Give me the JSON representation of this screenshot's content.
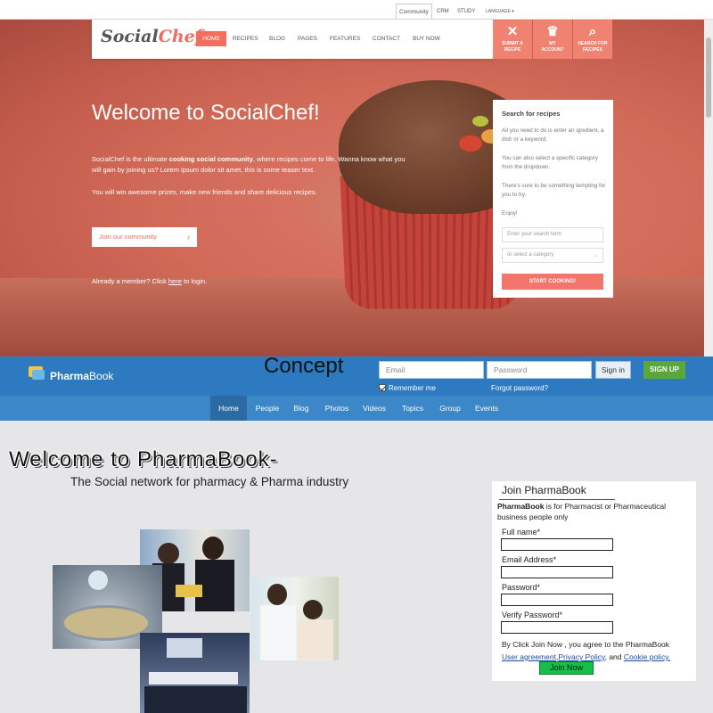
{
  "top_tabs": [
    "Community",
    "CRM",
    "STUDY",
    "LANGUAGE ▾"
  ],
  "socialchef": {
    "logo": {
      "part1": "Social",
      "part2": "Chef"
    },
    "nav": [
      "HOME",
      "RECIPES",
      "BLOG",
      "PAGES",
      "FEATURES",
      "CONTACT",
      "BUY NOW"
    ],
    "tiles": [
      {
        "icon": "✕",
        "label1": "SUBMIT A",
        "label2": "RECIPE"
      },
      {
        "icon": "♛",
        "label1": "MY",
        "label2": "ACCOUNT"
      },
      {
        "icon": "⌕",
        "label1": "SEARCH FOR",
        "label2": "RECIPES"
      }
    ],
    "hero_title": "Welcome to SocialChef!",
    "hero_p1_a": "SocialChef is the ultimate ",
    "hero_p1_b": "cooking social community",
    "hero_p1_c": ", where recipes come to life. Wanna know what you will gain by joining us? Lorem ipsum dolor sit amet, this is some teaser text.",
    "hero_p2": "You will win awesome prizes, make new friends and share delicious recipes.",
    "join_button": "Join our community",
    "member_a": "Already a member? Click ",
    "member_link": "here",
    "member_b": " to login.",
    "search": {
      "heading": "Search for recipes",
      "t1": "All you need to do is enter an igredient, a dish or a keyword.",
      "t2": "You can also select a specific category from the dropdown.",
      "t3": "There's sure to be something tempting for you to try.",
      "t4": "Enjoy!",
      "input_placeholder": "Enter your search term",
      "select_placeholder": "or select a category",
      "button": "START COOKING!"
    }
  },
  "pharmabook": {
    "logo_a": "Pharma",
    "logo_b": "Book",
    "concept": "Concept",
    "email_placeholder": "Email",
    "password_placeholder": "Password",
    "signin": "Sign in",
    "signup": "SIGN UP",
    "remember": "Remember me",
    "forgot": "Forgot password?",
    "nav": [
      "Home",
      "People",
      "Blog",
      "Photos",
      "Videos",
      "Topics",
      "Group",
      "Events"
    ],
    "welcome": "Welcome to PharmaBook-",
    "subtitle": "The Social network for pharmacy & Pharma industry",
    "join": {
      "title": "Join PharmaBook",
      "desc_brand": "PharmaBook",
      "desc_rest": " is for Pharmacist or Pharmaceutical business people only",
      "fields": [
        "Full name*",
        "Email Address*",
        "Password*",
        "Verify Password*"
      ],
      "agree_a": "By Click Join Now , you agree to the  PharmaBook",
      "agree_link1": "User agreement",
      "agree_link2": "Privacy Policy",
      "agree_and": ", and ",
      "agree_link3": "Cookie policy.",
      "button": "Join Now"
    }
  }
}
